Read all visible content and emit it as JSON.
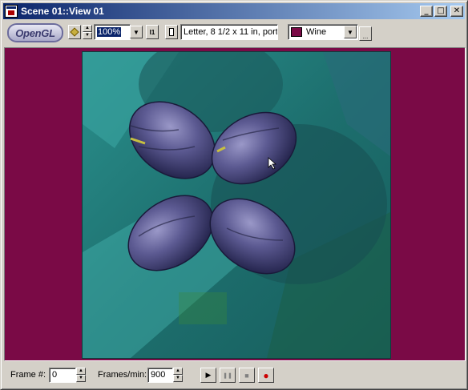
{
  "window": {
    "title": "Scene 01::View 01"
  },
  "titlebar_buttons": {
    "minimize": "_",
    "maximize": "□",
    "close": "✕"
  },
  "toolbar": {
    "logo_text": "OpenGL",
    "zoom_value": "100%",
    "paper_size": "Letter, 8 1/2 x 11 in, portra",
    "background_color_name": "Wine",
    "background_color": "#7a0a46",
    "fit_label": "I1",
    "more_label": "..."
  },
  "status": {
    "frame_label": "Frame #:",
    "frame_value": "0",
    "fpm_label": "Frames/min:",
    "fpm_value": "900",
    "play_glyph": "▶",
    "pause_glyph": "❚❚",
    "stop_glyph": "■",
    "record_glyph": "●"
  },
  "colors": {
    "titlebar_start": "#0a246a",
    "titlebar_end": "#a6caf0",
    "viewport_bg": "#7a0a46",
    "record_red": "#cc0000"
  }
}
